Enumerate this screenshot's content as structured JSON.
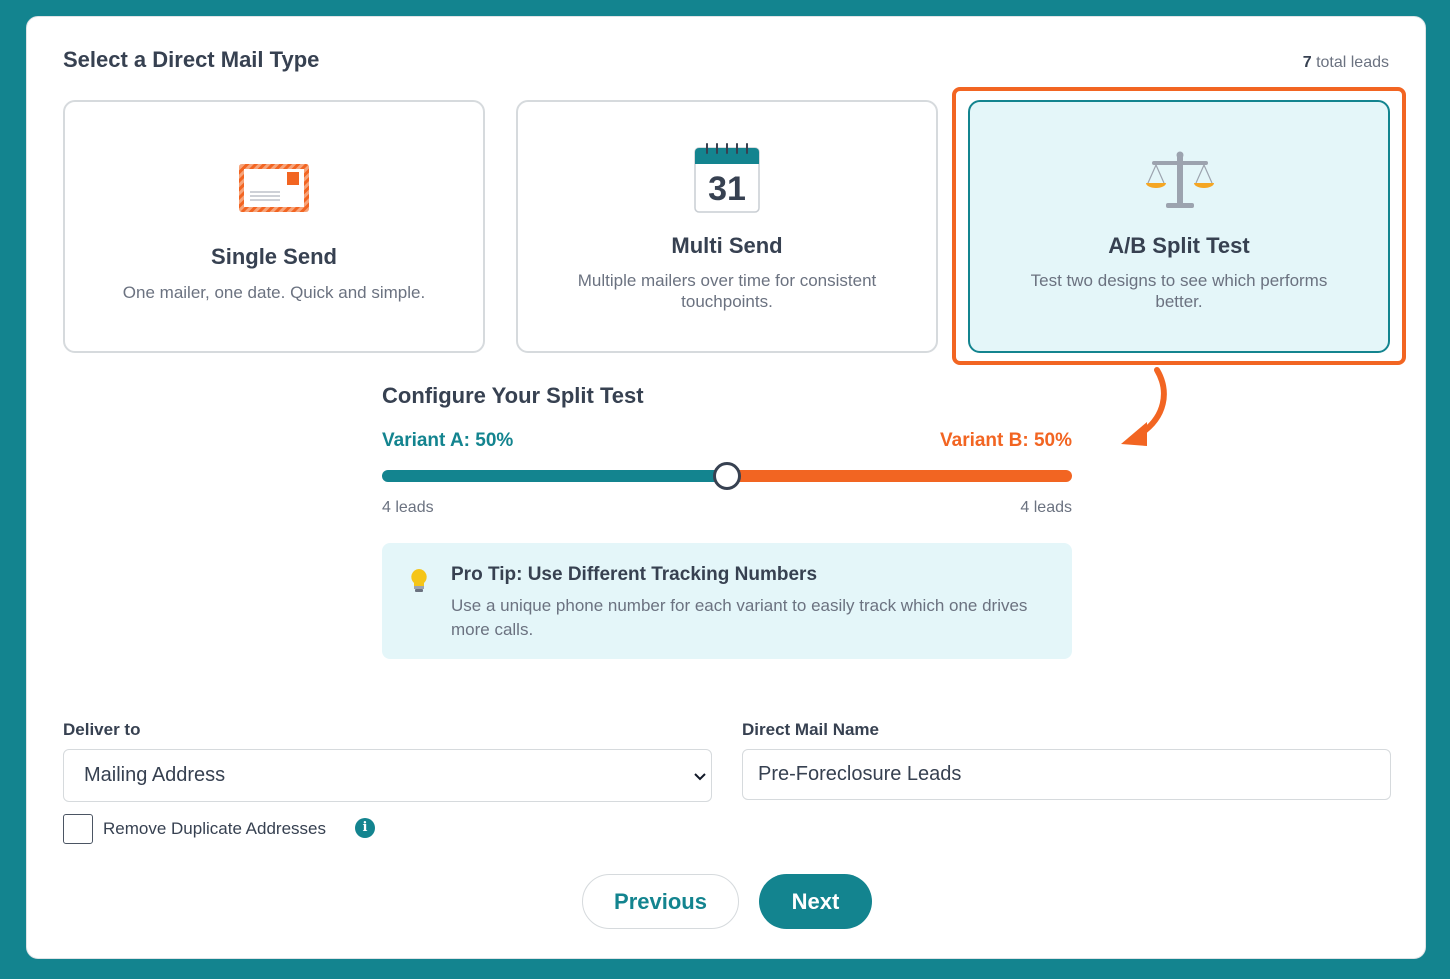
{
  "header": {
    "title": "Select a Direct Mail Type",
    "total_count": "7",
    "total_label": "total leads"
  },
  "mail_types": [
    {
      "title": "Single Send",
      "description": "One mailer, one date. Quick and simple.",
      "icon": "envelope-icon",
      "selected": false
    },
    {
      "title": "Multi Send",
      "description": "Multiple mailers over time for consistent touchpoints.",
      "icon": "calendar-icon",
      "icon_text": "31",
      "selected": false
    },
    {
      "title": "A/B Split Test",
      "description": "Test two designs to see which performs better.",
      "icon": "scale-icon",
      "selected": true
    }
  ],
  "split_test": {
    "title": "Configure Your Split Test",
    "variant_a_label": "Variant A: 50%",
    "variant_b_label": "Variant B: 50%",
    "split_fraction": 0.5,
    "variant_a_leads": "4 leads",
    "variant_b_leads": "4 leads"
  },
  "tip": {
    "icon": "lightbulb-icon",
    "title": "Pro Tip: Use Different Tracking Numbers",
    "text": "Use a unique phone number for each variant to easily track which one drives more calls."
  },
  "form": {
    "deliver_to_label": "Deliver to",
    "deliver_to_value": "Mailing Address",
    "name_label": "Direct Mail Name",
    "name_value": "Pre-Foreclosure Leads",
    "remove_duplicates_label": "Remove Duplicate Addresses",
    "remove_duplicates_checked": false
  },
  "buttons": {
    "previous": "Previous",
    "next": "Next"
  },
  "colors": {
    "background": "#13848f",
    "accent": "#13848f",
    "variant_b": "#f26522",
    "highlight": "#f26522"
  }
}
